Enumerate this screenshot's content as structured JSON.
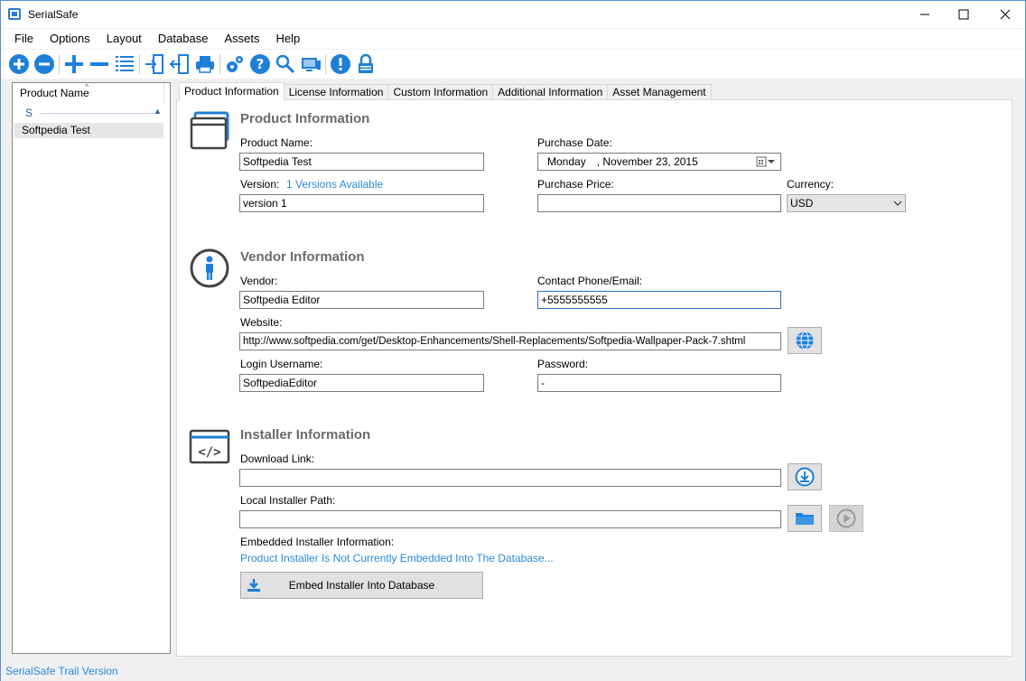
{
  "window": {
    "title": "SerialSafe"
  },
  "menu": [
    "File",
    "Options",
    "Layout",
    "Database",
    "Assets",
    "Help"
  ],
  "toolbar_icons": [
    "add-circle-icon",
    "remove-circle-icon",
    "plus-icon",
    "minus-icon",
    "list-icon",
    "import-icon",
    "export-icon",
    "print-icon",
    "settings-icon",
    "help-icon",
    "search-icon",
    "monitor-icon",
    "alert-icon",
    "lock-icon"
  ],
  "sidebar": {
    "header": "Product Name",
    "group": "S",
    "items": [
      "Softpedia Test"
    ]
  },
  "tabs": [
    "Product Information",
    "License Information",
    "Custom Information",
    "Additional Information",
    "Asset Management"
  ],
  "product": {
    "title": "Product Information",
    "name_label": "Product Name:",
    "name_value": "Softpedia Test",
    "purchase_date_label": "Purchase Date:",
    "purchase_date_day": "Monday",
    "purchase_date_rest": ", November 23, 2015",
    "version_label": "Version:",
    "versions_link": "1 Versions Available",
    "version_value": "version 1",
    "price_label": "Purchase Price:",
    "price_value": "",
    "currency_label": "Currency:",
    "currency_value": "USD"
  },
  "vendor": {
    "title": "Vendor Information",
    "vendor_label": "Vendor:",
    "vendor_value": "Softpedia Editor",
    "contact_label": "Contact Phone/Email:",
    "contact_value": "+5555555555",
    "website_label": "Website:",
    "website_value": "http://www.softpedia.com/get/Desktop-Enhancements/Shell-Replacements/Softpedia-Wallpaper-Pack-7.shtml",
    "login_label": "Login Username:",
    "login_value": "SoftpediaEditor",
    "password_label": "Password:",
    "password_value": "-"
  },
  "installer": {
    "title": "Installer Information",
    "download_label": "Download Link:",
    "download_value": "",
    "local_label": "Local Installer Path:",
    "local_value": "",
    "embedded_label": "Embedded Installer Information:",
    "embedded_status": "Product Installer Is Not Currently Embedded Into The Database...",
    "embed_button": "Embed Installer Into Database"
  },
  "status": "SerialSafe Trail Version"
}
